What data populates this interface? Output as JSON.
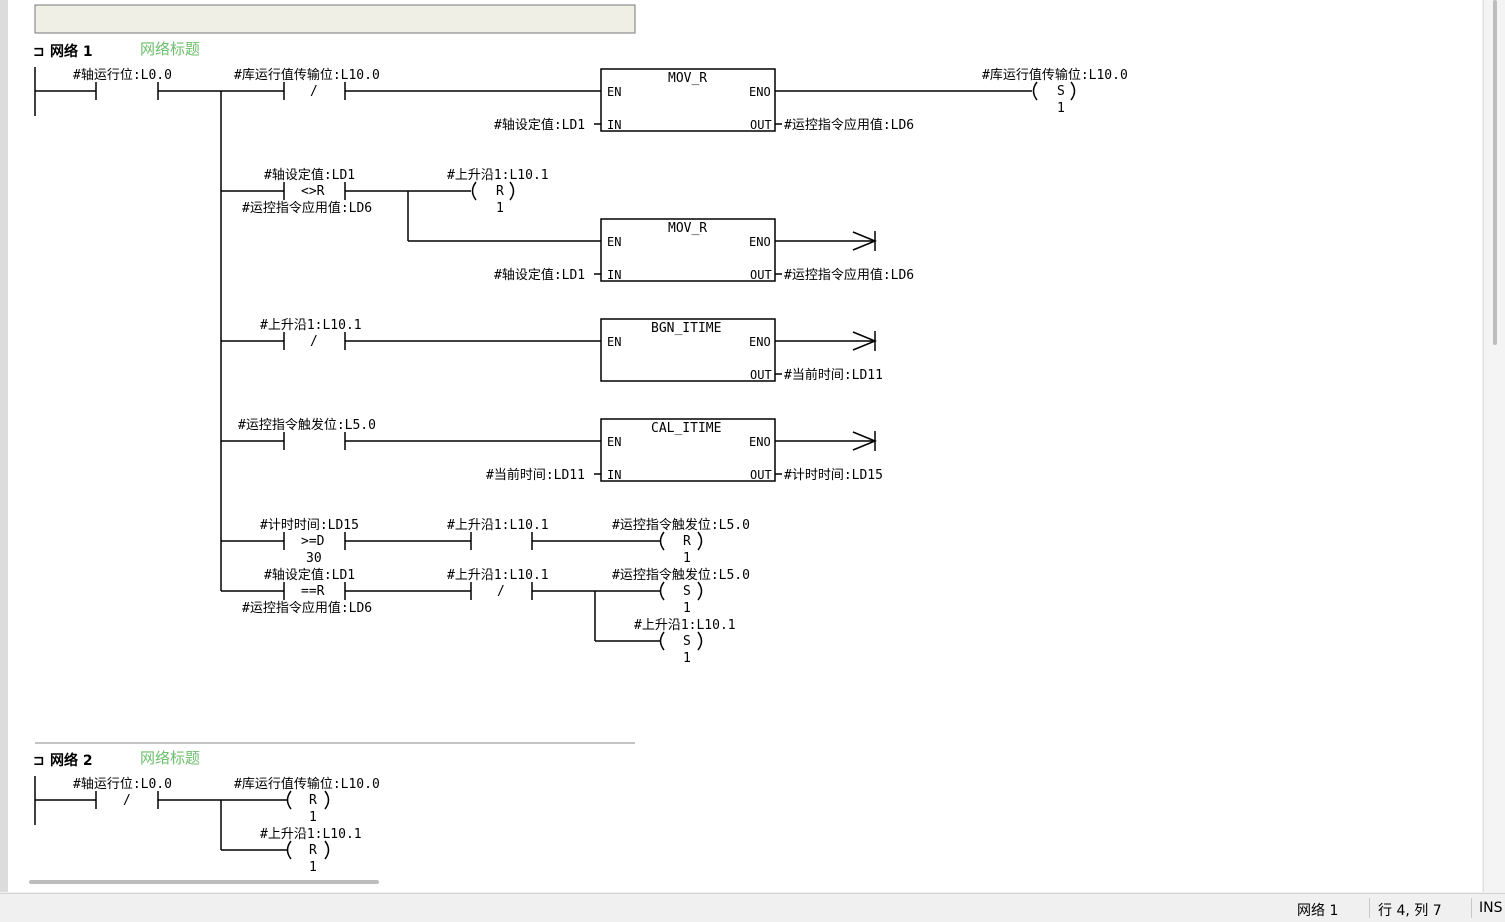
{
  "comment_box": "",
  "networks": [
    {
      "header": "网络 1",
      "title": "网络标题",
      "contacts": {
        "axis_run": {
          "label": "#轴运行位:L0.0",
          "symbol": ""
        },
        "lib_run_nc": {
          "label": "#库运行值传输位:L10.0",
          "symbol": "/"
        },
        "compare_ne": {
          "label_top": "#轴设定值:LD1",
          "symbol": "<>R",
          "label_bottom": "#运控指令应用值:LD6"
        },
        "rise_nc": {
          "label": "#上升沿1:L10.1",
          "symbol": "/"
        },
        "trigger": {
          "label": "#运控指令触发位:L5.0",
          "symbol": ""
        },
        "compare_ge": {
          "label_top": "#计时时间:LD15",
          "symbol": ">=D",
          "label_bottom": "30"
        },
        "rise_no": {
          "label": "#上升沿1:L10.1",
          "symbol": ""
        },
        "compare_eq": {
          "label_top": "#轴设定值:LD1",
          "symbol": "==R",
          "label_bottom": "#运控指令应用值:LD6"
        },
        "rise_nc2": {
          "label": "#上升沿1:L10.1",
          "symbol": "/"
        }
      },
      "coils": {
        "set_lib_run": {
          "label": "#库运行值传输位:L10.0",
          "type": "S",
          "count": "1"
        },
        "reset_rise": {
          "label": "#上升沿1:L10.1",
          "type": "R",
          "count": "1"
        },
        "reset_trigger": {
          "label": "#运控指令触发位:L5.0",
          "type": "R",
          "count": "1"
        },
        "set_trigger": {
          "label": "#运控指令触发位:L5.0",
          "type": "S",
          "count": "1"
        },
        "set_rise": {
          "label": "#上升沿1:L10.1",
          "type": "S",
          "count": "1"
        }
      },
      "boxes": {
        "mov1": {
          "name": "MOV_R",
          "en": "EN",
          "eno": "ENO",
          "in": "IN",
          "out": "OUT",
          "in_label": "#轴设定值:LD1",
          "out_label": "#运控指令应用值:LD6"
        },
        "mov2": {
          "name": "MOV_R",
          "en": "EN",
          "eno": "ENO",
          "in": "IN",
          "out": "OUT",
          "in_label": "#轴设定值:LD1",
          "out_label": "#运控指令应用值:LD6"
        },
        "bgn": {
          "name": "BGN_ITIME",
          "en": "EN",
          "eno": "ENO",
          "out": "OUT",
          "out_label": "#当前时间:LD11"
        },
        "cal": {
          "name": "CAL_ITIME",
          "en": "EN",
          "eno": "ENO",
          "in": "IN",
          "out": "OUT",
          "in_label": "#当前时间:LD11",
          "out_label": "#计时时间:LD15"
        }
      }
    },
    {
      "header": "网络 2",
      "title": "网络标题",
      "contacts": {
        "axis_run_nc": {
          "label": "#轴运行位:L0.0",
          "symbol": "/"
        }
      },
      "coils": {
        "reset_lib_run": {
          "label": "#库运行值传输位:L10.0",
          "type": "R",
          "count": "1"
        },
        "reset_rise": {
          "label": "#上升沿1:L10.1",
          "type": "R",
          "count": "1"
        }
      }
    }
  ],
  "statusbar": {
    "network": "网络 1",
    "position": "行 4, 列 7",
    "mode": "INS"
  }
}
